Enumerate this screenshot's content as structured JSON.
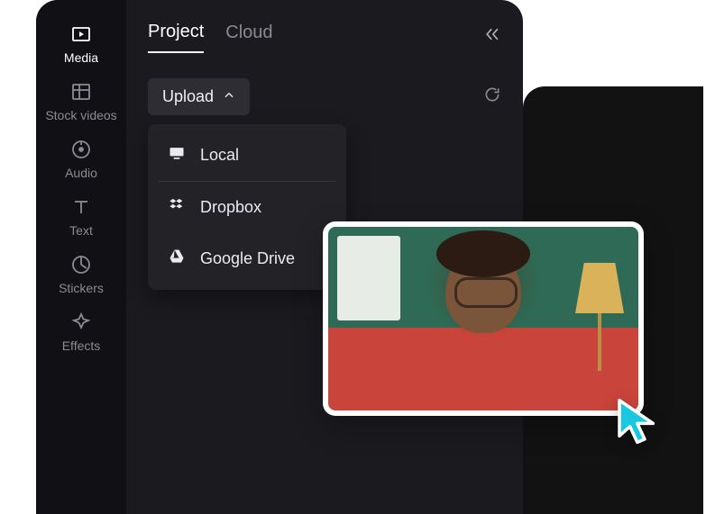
{
  "sidebar": {
    "items": [
      {
        "label": "Media"
      },
      {
        "label": "Stock videos"
      },
      {
        "label": "Audio"
      },
      {
        "label": "Text"
      },
      {
        "label": "Stickers"
      },
      {
        "label": "Effects"
      }
    ]
  },
  "tabs": {
    "project": "Project",
    "cloud": "Cloud"
  },
  "toolbar": {
    "upload_label": "Upload"
  },
  "upload_menu": {
    "local": "Local",
    "dropbox": "Dropbox",
    "google_drive": "Google Drive"
  }
}
